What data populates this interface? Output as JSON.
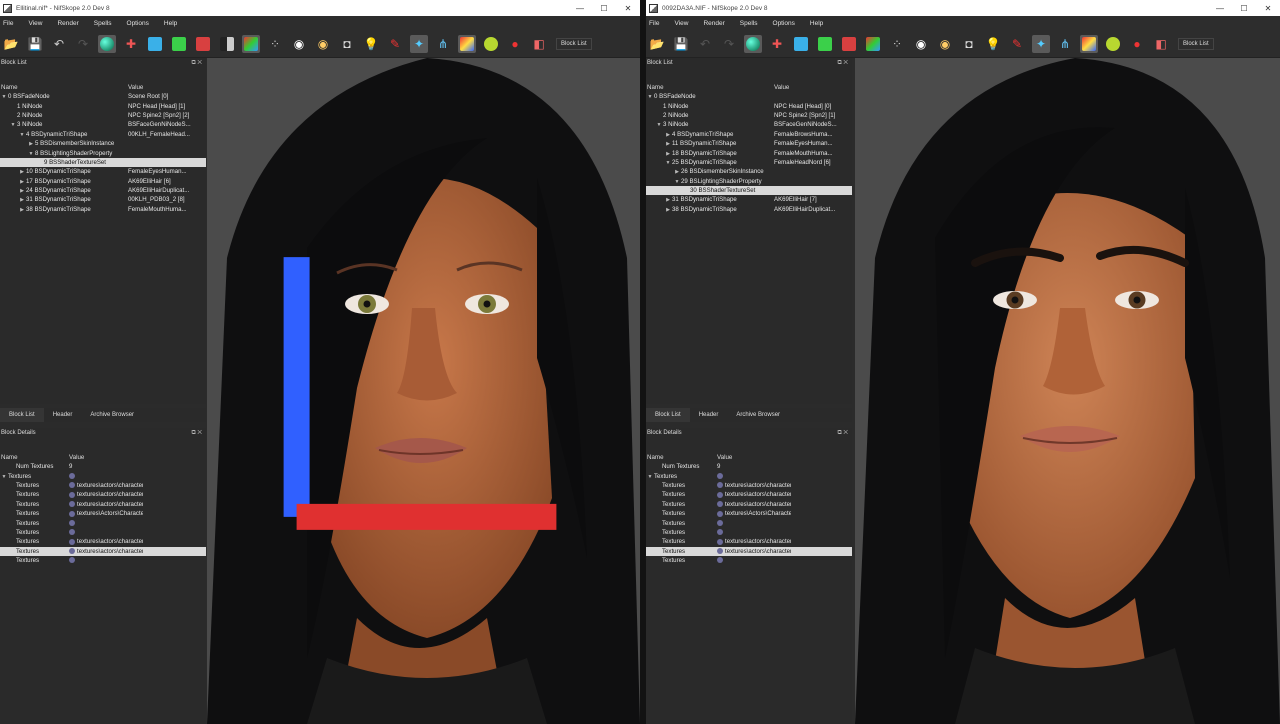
{
  "colors": {
    "titlebar": "#ffffff",
    "panel": "#2b2b2b",
    "selection": "#d9d9d9",
    "viewport": "#505050"
  },
  "menu": [
    "File",
    "View",
    "Render",
    "Spells",
    "Options",
    "Help"
  ],
  "toolbar_icons": [
    "load-icon",
    "save-icon",
    "undo-icon",
    "redo-icon",
    "globe-icon",
    "tools-icon",
    "cube-blue-icon",
    "cube-green-icon",
    "cube-red-icon",
    "cube-half-icon",
    "cube-colored-icon",
    "footprints-icon",
    "eye-icon",
    "eye-alt-icon",
    "camera-icon",
    "lightbulb-icon",
    "brush-icon",
    "vertex-icon",
    "node-icon",
    "texture-icon",
    "sphere-icon",
    "marker-icon",
    "eraser-icon"
  ],
  "left": {
    "title": "Ellitinal.nif* - NifSkope 2.0 Dev 8",
    "block_list_title": "Block List",
    "block_list_button": "Block List",
    "tree_headers": [
      "Name",
      "Value"
    ],
    "tree": [
      {
        "d": 0,
        "a": "▼",
        "n": "0 BSFadeNode",
        "v": "Scene Root [0]"
      },
      {
        "d": 1,
        "a": "",
        "n": "1 NiNode",
        "v": "NPC Head [Head] [1]"
      },
      {
        "d": 1,
        "a": "",
        "n": "2 NiNode",
        "v": "NPC Spine2 [Spn2] [2]"
      },
      {
        "d": 1,
        "a": "▼",
        "n": "3 NiNode",
        "v": "BSFaceGenNiNodeS..."
      },
      {
        "d": 2,
        "a": "▼",
        "n": "4 BSDynamicTriShape",
        "v": "00KLH_FemaleHead..."
      },
      {
        "d": 3,
        "a": "▶",
        "n": "5 BSDismemberSkinInstance",
        "v": ""
      },
      {
        "d": 3,
        "a": "▼",
        "n": "8 BSLightingShaderProperty",
        "v": ""
      },
      {
        "d": 4,
        "a": "",
        "n": "9 BSShaderTextureSet",
        "v": "",
        "sel": true
      },
      {
        "d": 2,
        "a": "▶",
        "n": "10 BSDynamicTriShape",
        "v": "FemaleEyesHuman..."
      },
      {
        "d": 2,
        "a": "▶",
        "n": "17 BSDynamicTriShape",
        "v": "AK69ElliHair [6]"
      },
      {
        "d": 2,
        "a": "▶",
        "n": "24 BSDynamicTriShape",
        "v": "AK69ElliHairDuplicat..."
      },
      {
        "d": 2,
        "a": "▶",
        "n": "31 BSDynamicTriShape",
        "v": "00KLH_PDB03_2 [8]"
      },
      {
        "d": 2,
        "a": "▶",
        "n": "38 BSDynamicTriShape",
        "v": "FemaleMouthHuma..."
      }
    ],
    "tabs": [
      "Block List",
      "Header",
      "Archive Browser"
    ],
    "block_details_title": "Block Details",
    "details_headers": [
      "Name",
      "Value"
    ],
    "details": [
      {
        "d": 1,
        "a": "",
        "n": "Num Textures",
        "v": "9",
        "i": false
      },
      {
        "d": 0,
        "a": "▼",
        "n": "Textures",
        "v": "",
        "i": true
      },
      {
        "d": 1,
        "a": "",
        "n": "Textures",
        "v": "textures\\actors\\character\\Katana\\body\\Fema",
        "i": true
      },
      {
        "d": 1,
        "a": "",
        "n": "Textures",
        "v": "textures\\actors\\character\\Katana\\body\\Fema",
        "i": true
      },
      {
        "d": 1,
        "a": "",
        "n": "Textures",
        "v": "textures\\actors\\character\\Katana\\body\\Fema",
        "i": true
      },
      {
        "d": 1,
        "a": "",
        "n": "Textures",
        "v": "textures\\Actors\\Character\\Male\\BlankDetailn",
        "i": true
      },
      {
        "d": 1,
        "a": "",
        "n": "Textures",
        "v": "",
        "i": true
      },
      {
        "d": 1,
        "a": "",
        "n": "Textures",
        "v": "",
        "i": true
      },
      {
        "d": 1,
        "a": "",
        "n": "Textures",
        "v": "textures\\actors\\character\\FaceGenData\\Face",
        "i": true
      },
      {
        "d": 1,
        "a": "",
        "n": "Textures",
        "v": "textures\\actors\\character\\Katana\\body\\Fema",
        "i": true,
        "sel": true
      },
      {
        "d": 1,
        "a": "",
        "n": "Textures",
        "v": "",
        "i": true
      }
    ]
  },
  "right": {
    "title": "0092DA3A.NIF - NifSkope 2.0 Dev 8",
    "block_list_title": "Block List",
    "block_list_button": "Block List",
    "tree_headers": [
      "Name",
      "Value"
    ],
    "tree": [
      {
        "d": 0,
        "a": "▼",
        "n": "0 BSFadeNode",
        "v": ""
      },
      {
        "d": 1,
        "a": "",
        "n": "1 NiNode",
        "v": "NPC Head [Head] [0]"
      },
      {
        "d": 1,
        "a": "",
        "n": "2 NiNode",
        "v": "NPC Spine2 [Spn2] [1]"
      },
      {
        "d": 1,
        "a": "▼",
        "n": "3 NiNode",
        "v": "BSFaceGenNiNodeS..."
      },
      {
        "d": 2,
        "a": "▶",
        "n": "4 BSDynamicTriShape",
        "v": "FemaleBrowsHuma..."
      },
      {
        "d": 2,
        "a": "▶",
        "n": "11 BSDynamicTriShape",
        "v": "FemaleEyesHuman..."
      },
      {
        "d": 2,
        "a": "▶",
        "n": "18 BSDynamicTriShape",
        "v": "FemaleMouthHuma..."
      },
      {
        "d": 2,
        "a": "▼",
        "n": "25 BSDynamicTriShape",
        "v": "FemaleHeadNord [6]"
      },
      {
        "d": 3,
        "a": "▶",
        "n": "26 BSDismemberSkinInstance",
        "v": ""
      },
      {
        "d": 3,
        "a": "▼",
        "n": "29 BSLightingShaderProperty",
        "v": ""
      },
      {
        "d": 4,
        "a": "",
        "n": "30 BSShaderTextureSet",
        "v": "",
        "sel": true
      },
      {
        "d": 2,
        "a": "▶",
        "n": "31 BSDynamicTriShape",
        "v": "AK69ElliHair [7]"
      },
      {
        "d": 2,
        "a": "▶",
        "n": "38 BSDynamicTriShape",
        "v": "AK69ElliHairDuplicat..."
      }
    ],
    "tabs": [
      "Block List",
      "Header",
      "Archive Browser"
    ],
    "block_details_title": "Block Details",
    "details_headers": [
      "Name",
      "Value"
    ],
    "details": [
      {
        "d": 1,
        "a": "",
        "n": "Num Textures",
        "v": "9",
        "i": false
      },
      {
        "d": 0,
        "a": "▼",
        "n": "Textures",
        "v": "",
        "i": true
      },
      {
        "d": 1,
        "a": "",
        "n": "Textures",
        "v": "textures\\actors\\character\\Katana\\body\\Fema",
        "i": true
      },
      {
        "d": 1,
        "a": "",
        "n": "Textures",
        "v": "textures\\actors\\character\\Katana\\body\\Fema",
        "i": true
      },
      {
        "d": 1,
        "a": "",
        "n": "Textures",
        "v": "textures\\actors\\character\\Katana\\body\\Fema",
        "i": true
      },
      {
        "d": 1,
        "a": "",
        "n": "Textures",
        "v": "textures\\Actors\\Character\\Male\\BlankDetailn",
        "i": true
      },
      {
        "d": 1,
        "a": "",
        "n": "Textures",
        "v": "",
        "i": true
      },
      {
        "d": 1,
        "a": "",
        "n": "Textures",
        "v": "",
        "i": true
      },
      {
        "d": 1,
        "a": "",
        "n": "Textures",
        "v": "textures\\actors\\character\\FaceGenData\\Face",
        "i": true
      },
      {
        "d": 1,
        "a": "",
        "n": "Textures",
        "v": "textures\\actors\\character\\Katana\\body\\Female",
        "i": true,
        "sel": true
      },
      {
        "d": 1,
        "a": "",
        "n": "Textures",
        "v": "",
        "i": true
      }
    ]
  }
}
